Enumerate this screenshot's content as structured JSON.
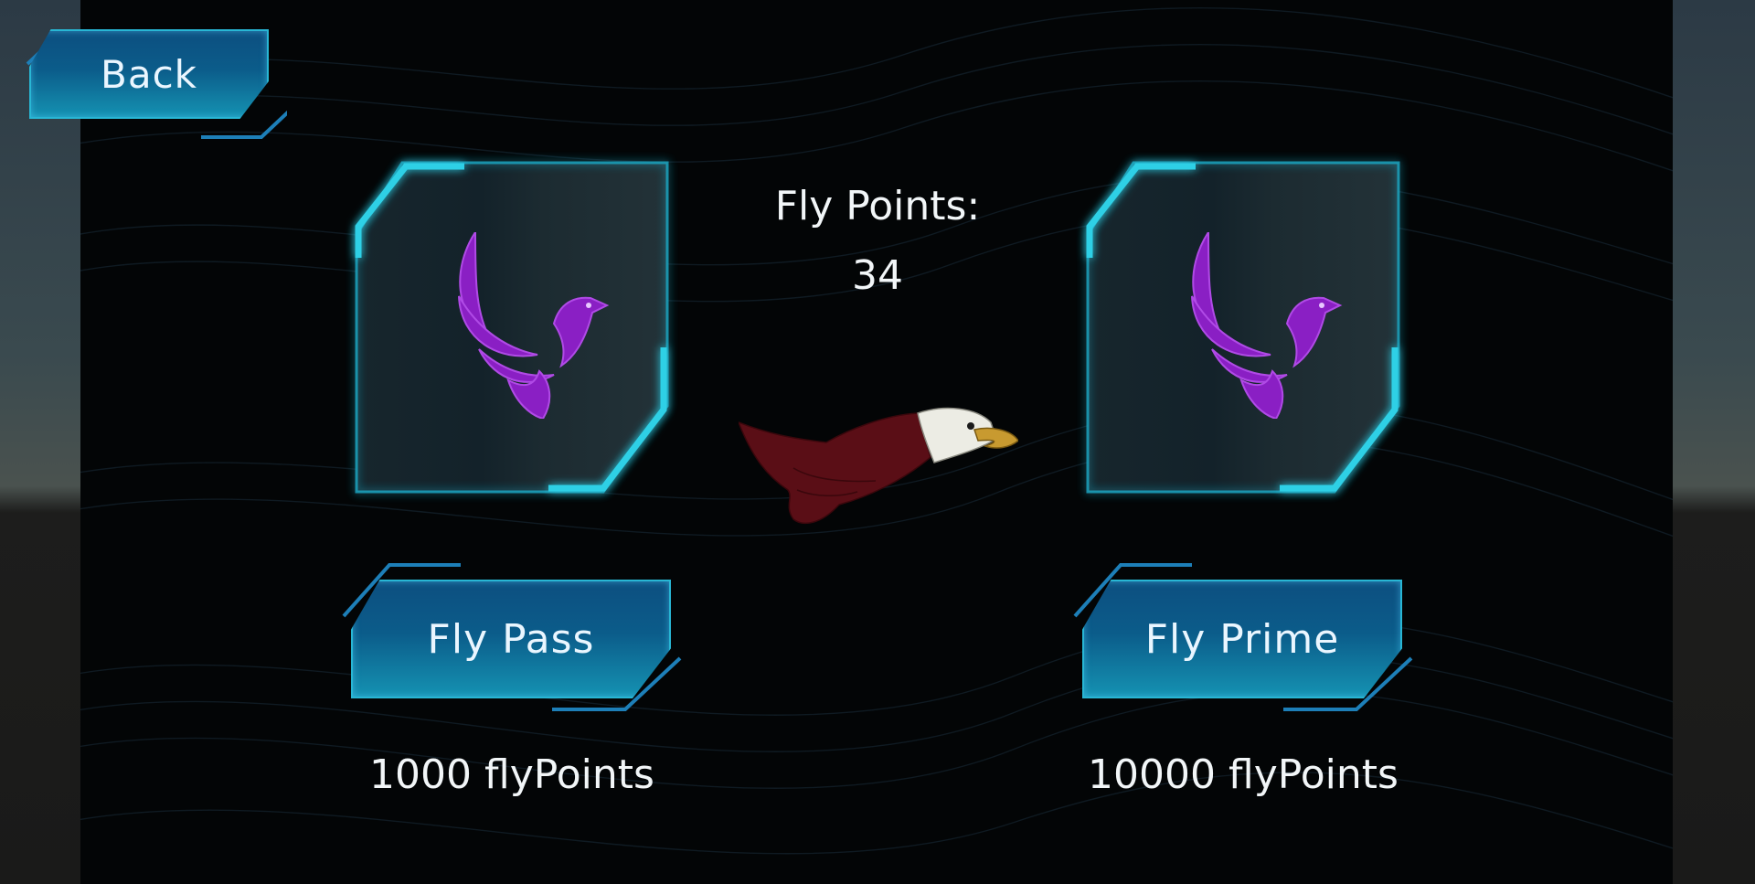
{
  "header": {
    "back_label": "Back"
  },
  "points": {
    "label": "Fly Points:",
    "value": "34"
  },
  "offers": [
    {
      "button_label": "Fly Pass",
      "price": "1000 flyPoints",
      "icon": "purple-bird-logo-icon"
    },
    {
      "button_label": "Fly Prime",
      "price": "10000 flyPoints",
      "icon": "purple-bird-logo-icon"
    }
  ],
  "mascot": {
    "icon": "eagle-mascot-icon"
  },
  "colors": {
    "accent": "#1fb3cf",
    "button_dark": "#0d4f80",
    "button_light": "#1592b2",
    "logo": "#8a1fc4",
    "text": "#f2f6f8"
  }
}
